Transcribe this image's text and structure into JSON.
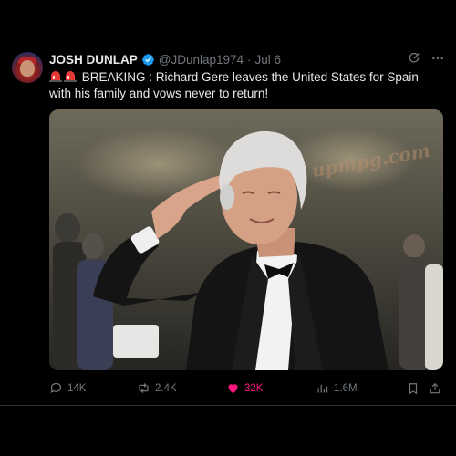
{
  "tweet": {
    "author": {
      "name": "JOSH DUNLAP",
      "handle": "@JDunlap1974",
      "separator": "·",
      "date": "Jul 6",
      "verified": true
    },
    "text": "BREAKING : Richard Gere leaves the United States for Spain with his family and vows never to return!",
    "prefix_icons": [
      "siren-icon",
      "siren-icon"
    ],
    "media": {
      "watermark": "upmpg.com"
    },
    "stats": {
      "replies": "14K",
      "retweets": "2.4K",
      "likes": "32K",
      "views": "1.6M"
    },
    "header_icons": [
      "grok-icon",
      "more-icon"
    ],
    "colors": {
      "background": "#000000",
      "text": "#e7e9ea",
      "muted": "#71767b",
      "like": "#f91880",
      "verified": "#1d9bf0"
    }
  }
}
